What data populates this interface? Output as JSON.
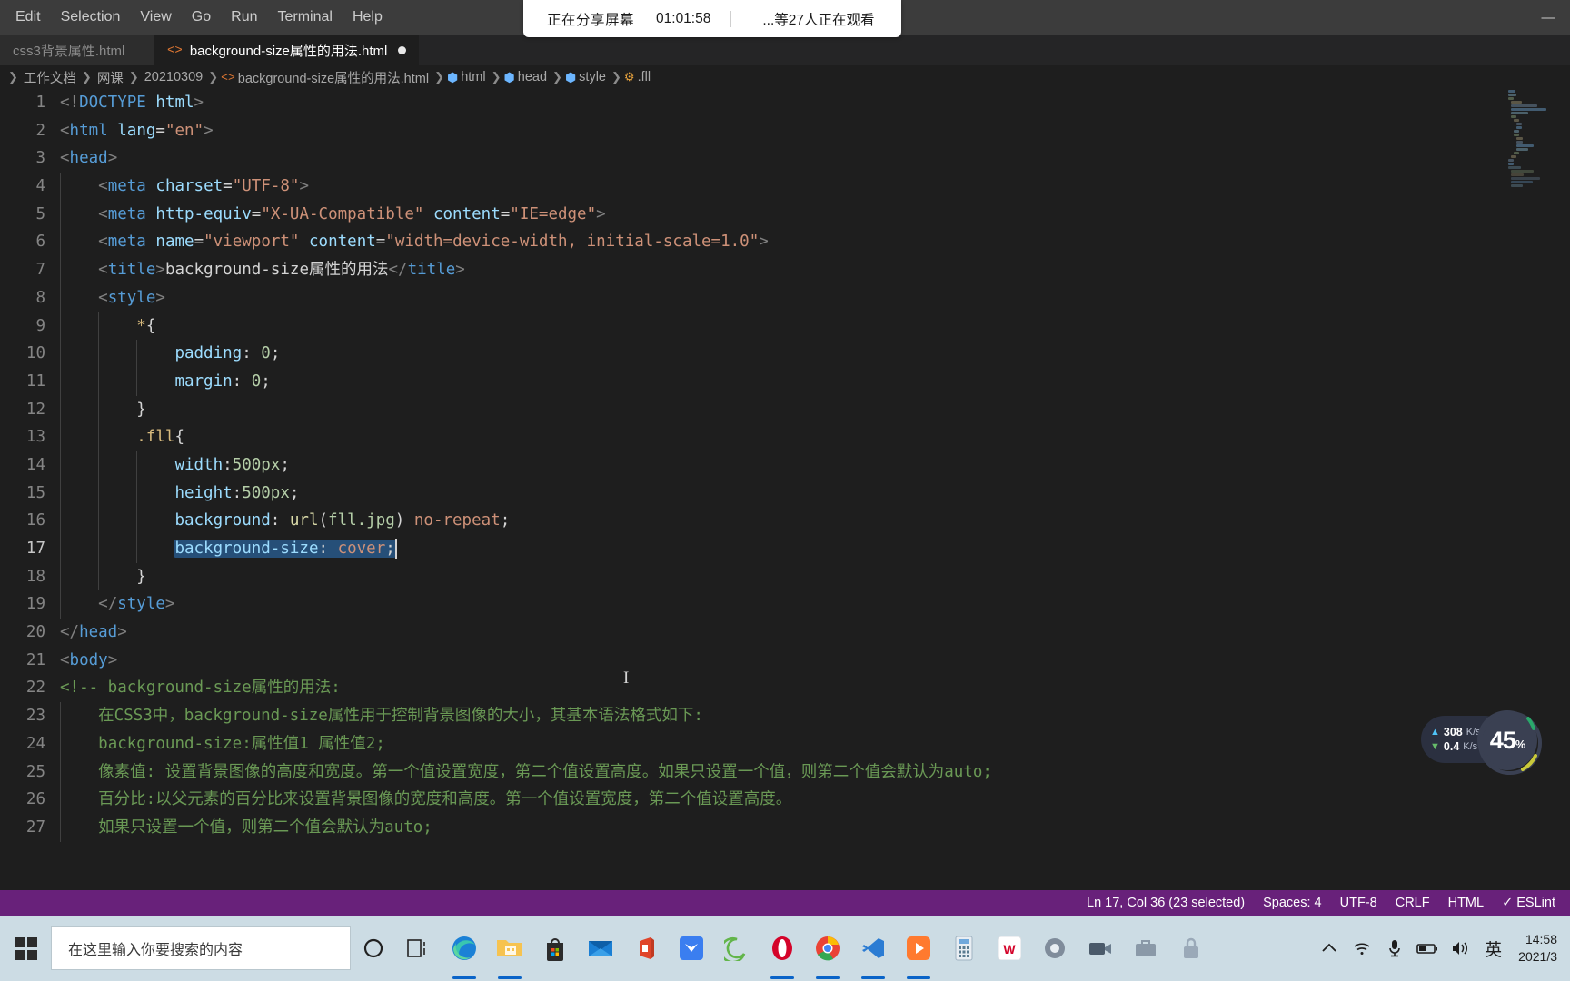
{
  "window": {
    "menu": [
      "Edit",
      "Selection",
      "View",
      "Go",
      "Run",
      "Terminal",
      "Help"
    ],
    "minimize_glyph": "—"
  },
  "share_banner": {
    "status": "正在分享屏幕",
    "timer": "01:01:58",
    "viewers": "...等27人正在观看"
  },
  "tabs": [
    {
      "label": "css3背景属性.html",
      "active": false,
      "dirty": false,
      "icon": "html-file-icon"
    },
    {
      "label": "background-size属性的用法.html",
      "active": true,
      "dirty": true,
      "icon": "html-file-icon"
    }
  ],
  "breadcrumb": [
    {
      "label": "工作文档",
      "icon": ""
    },
    {
      "label": "网课",
      "icon": ""
    },
    {
      "label": "20210309",
      "icon": ""
    },
    {
      "label": "background-size属性的用法.html",
      "icon": "html-file-icon"
    },
    {
      "label": "html",
      "icon": "symbol-cube-icon"
    },
    {
      "label": "head",
      "icon": "symbol-cube-icon"
    },
    {
      "label": "style",
      "icon": "symbol-cube-icon"
    },
    {
      "label": ".fll",
      "icon": "css-rule-icon"
    }
  ],
  "editor": {
    "first_line": 1,
    "lines": [
      {
        "n": 1,
        "indent": 0,
        "tokens": [
          {
            "t": "punct",
            "s": "<!"
          },
          {
            "t": "tag",
            "s": "DOCTYPE"
          },
          {
            "t": "plain",
            "s": " "
          },
          {
            "t": "attr",
            "s": "html"
          },
          {
            "t": "punct",
            "s": ">"
          }
        ]
      },
      {
        "n": 2,
        "indent": 0,
        "tokens": [
          {
            "t": "punct",
            "s": "<"
          },
          {
            "t": "tag",
            "s": "html"
          },
          {
            "t": "plain",
            "s": " "
          },
          {
            "t": "attr",
            "s": "lang"
          },
          {
            "t": "plain",
            "s": "="
          },
          {
            "t": "str",
            "s": "\"en\""
          },
          {
            "t": "punct",
            "s": ">"
          }
        ]
      },
      {
        "n": 3,
        "indent": 0,
        "tokens": [
          {
            "t": "punct",
            "s": "<"
          },
          {
            "t": "tag",
            "s": "head"
          },
          {
            "t": "punct",
            "s": ">"
          }
        ]
      },
      {
        "n": 4,
        "indent": 1,
        "tokens": [
          {
            "t": "punct",
            "s": "<"
          },
          {
            "t": "tag",
            "s": "meta"
          },
          {
            "t": "plain",
            "s": " "
          },
          {
            "t": "attr",
            "s": "charset"
          },
          {
            "t": "plain",
            "s": "="
          },
          {
            "t": "str",
            "s": "\"UTF-8\""
          },
          {
            "t": "punct",
            "s": ">"
          }
        ]
      },
      {
        "n": 5,
        "indent": 1,
        "tokens": [
          {
            "t": "punct",
            "s": "<"
          },
          {
            "t": "tag",
            "s": "meta"
          },
          {
            "t": "plain",
            "s": " "
          },
          {
            "t": "attr",
            "s": "http-equiv"
          },
          {
            "t": "plain",
            "s": "="
          },
          {
            "t": "str",
            "s": "\"X-UA-Compatible\""
          },
          {
            "t": "plain",
            "s": " "
          },
          {
            "t": "attr",
            "s": "content"
          },
          {
            "t": "plain",
            "s": "="
          },
          {
            "t": "str",
            "s": "\"IE=edge\""
          },
          {
            "t": "punct",
            "s": ">"
          }
        ]
      },
      {
        "n": 6,
        "indent": 1,
        "tokens": [
          {
            "t": "punct",
            "s": "<"
          },
          {
            "t": "tag",
            "s": "meta"
          },
          {
            "t": "plain",
            "s": " "
          },
          {
            "t": "attr",
            "s": "name"
          },
          {
            "t": "plain",
            "s": "="
          },
          {
            "t": "str",
            "s": "\"viewport\""
          },
          {
            "t": "plain",
            "s": " "
          },
          {
            "t": "attr",
            "s": "content"
          },
          {
            "t": "plain",
            "s": "="
          },
          {
            "t": "str",
            "s": "\"width=device-width, initial-scale=1.0\""
          },
          {
            "t": "punct",
            "s": ">"
          }
        ]
      },
      {
        "n": 7,
        "indent": 1,
        "tokens": [
          {
            "t": "punct",
            "s": "<"
          },
          {
            "t": "tag",
            "s": "title"
          },
          {
            "t": "punct",
            "s": ">"
          },
          {
            "t": "plain",
            "s": "background-size属性的用法"
          },
          {
            "t": "punct",
            "s": "</"
          },
          {
            "t": "tag",
            "s": "title"
          },
          {
            "t": "punct",
            "s": ">"
          }
        ]
      },
      {
        "n": 8,
        "indent": 1,
        "tokens": [
          {
            "t": "punct",
            "s": "<"
          },
          {
            "t": "tag",
            "s": "style"
          },
          {
            "t": "punct",
            "s": ">"
          }
        ]
      },
      {
        "n": 9,
        "indent": 2,
        "tokens": [
          {
            "t": "sel",
            "s": "*"
          },
          {
            "t": "brace",
            "s": "{"
          }
        ]
      },
      {
        "n": 10,
        "indent": 3,
        "tokens": [
          {
            "t": "prop",
            "s": "padding"
          },
          {
            "t": "plain",
            "s": ": "
          },
          {
            "t": "num",
            "s": "0"
          },
          {
            "t": "plain",
            "s": ";"
          }
        ]
      },
      {
        "n": 11,
        "indent": 3,
        "tokens": [
          {
            "t": "prop",
            "s": "margin"
          },
          {
            "t": "plain",
            "s": ": "
          },
          {
            "t": "num",
            "s": "0"
          },
          {
            "t": "plain",
            "s": ";"
          }
        ]
      },
      {
        "n": 12,
        "indent": 2,
        "tokens": [
          {
            "t": "brace",
            "s": "}"
          }
        ]
      },
      {
        "n": 13,
        "indent": 2,
        "tokens": [
          {
            "t": "sel",
            "s": ".fll"
          },
          {
            "t": "brace",
            "s": "{"
          }
        ]
      },
      {
        "n": 14,
        "indent": 3,
        "tokens": [
          {
            "t": "prop",
            "s": "width"
          },
          {
            "t": "plain",
            "s": ":"
          },
          {
            "t": "num",
            "s": "500px"
          },
          {
            "t": "plain",
            "s": ";"
          }
        ]
      },
      {
        "n": 15,
        "indent": 3,
        "tokens": [
          {
            "t": "prop",
            "s": "height"
          },
          {
            "t": "plain",
            "s": ":"
          },
          {
            "t": "num",
            "s": "500px"
          },
          {
            "t": "plain",
            "s": ";"
          }
        ]
      },
      {
        "n": 16,
        "indent": 3,
        "tokens": [
          {
            "t": "prop",
            "s": "background"
          },
          {
            "t": "plain",
            "s": ": "
          },
          {
            "t": "fn",
            "s": "url"
          },
          {
            "t": "plain",
            "s": "("
          },
          {
            "t": "num",
            "s": "fll.jpg"
          },
          {
            "t": "plain",
            "s": ") "
          },
          {
            "t": "val",
            "s": "no-repeat"
          },
          {
            "t": "plain",
            "s": ";"
          }
        ]
      },
      {
        "n": 17,
        "indent": 3,
        "current": true,
        "selected": true,
        "tokens": [
          {
            "t": "prop",
            "s": "background-size"
          },
          {
            "t": "plain",
            "s": ": "
          },
          {
            "t": "val",
            "s": "cover"
          },
          {
            "t": "plain",
            "s": ";"
          }
        ]
      },
      {
        "n": 18,
        "indent": 2,
        "tokens": [
          {
            "t": "brace",
            "s": "}"
          }
        ]
      },
      {
        "n": 19,
        "indent": 1,
        "tokens": [
          {
            "t": "punct",
            "s": "</"
          },
          {
            "t": "tag",
            "s": "style"
          },
          {
            "t": "punct",
            "s": ">"
          }
        ]
      },
      {
        "n": 20,
        "indent": 0,
        "tokens": [
          {
            "t": "punct",
            "s": "</"
          },
          {
            "t": "tag",
            "s": "head"
          },
          {
            "t": "punct",
            "s": ">"
          }
        ]
      },
      {
        "n": 21,
        "indent": 0,
        "tokens": [
          {
            "t": "punct",
            "s": "<"
          },
          {
            "t": "tag",
            "s": "body"
          },
          {
            "t": "punct",
            "s": ">"
          }
        ]
      },
      {
        "n": 22,
        "indent": 0,
        "tokens": [
          {
            "t": "comment",
            "s": "<!-- background-size属性的用法:"
          }
        ]
      },
      {
        "n": 23,
        "indent": 1,
        "tokens": [
          {
            "t": "comment",
            "s": "在CSS3中，background-size属性用于控制背景图像的大小，其基本语法格式如下:"
          }
        ]
      },
      {
        "n": 24,
        "indent": 1,
        "tokens": [
          {
            "t": "comment",
            "s": "background-size:属性值1 属性值2;"
          }
        ]
      },
      {
        "n": 25,
        "indent": 1,
        "tokens": [
          {
            "t": "comment",
            "s": "像素值: 设置背景图像的高度和宽度。第一个值设置宽度，第二个值设置高度。如果只设置一个值，则第二个值会默认为auto;"
          }
        ]
      },
      {
        "n": 26,
        "indent": 1,
        "tokens": [
          {
            "t": "comment",
            "s": "百分比:以父元素的百分比来设置背景图像的宽度和高度。第一个值设置宽度，第二个值设置高度。"
          }
        ]
      },
      {
        "n": 27,
        "indent": 1,
        "tokens": [
          {
            "t": "comment",
            "s": "如果只设置一个值，则第二个值会默认为auto;"
          }
        ]
      }
    ]
  },
  "statusbar": {
    "position": "Ln 17, Col 36 (23 selected)",
    "spaces": "Spaces: 4",
    "encoding": "UTF-8",
    "eol": "CRLF",
    "language": "HTML",
    "eslint": "ESLint",
    "eslint_icon": "check-icon"
  },
  "network_widget": {
    "upload": "308",
    "upload_unit": "K/s",
    "download": "0.4",
    "download_unit": "K/s",
    "percent": "45",
    "percent_sign": "%"
  },
  "taskbar": {
    "search_placeholder": "在这里输入你要搜索的内容",
    "start_icon": "windows-logo-icon",
    "cortana_icon": "cortana-circle-icon",
    "taskview_icon": "task-view-icon",
    "apps": [
      {
        "name": "edge-icon",
        "glyph": "e",
        "color": "#3b7fd4"
      },
      {
        "name": "file-explorer-icon",
        "glyph": "",
        "color": "#ffc942"
      },
      {
        "name": "microsoft-store-icon",
        "glyph": "",
        "color": "#2a2a2a"
      },
      {
        "name": "mail-icon",
        "glyph": "",
        "color": "#1f7fd4"
      },
      {
        "name": "office-icon",
        "glyph": "",
        "color": "#e0452a"
      },
      {
        "name": "foxmail-icon",
        "glyph": "",
        "color": "#3a7ef0"
      },
      {
        "name": "internet-explorer-icon",
        "glyph": "e",
        "color": "#62b54a"
      },
      {
        "name": "opera-icon",
        "glyph": "O",
        "color": "#d4042a"
      },
      {
        "name": "chrome-icon",
        "glyph": "",
        "color": "#ea4335"
      },
      {
        "name": "vscode-icon",
        "glyph": "",
        "color": "#2b7cd3"
      },
      {
        "name": "player-icon",
        "glyph": "▶",
        "color": "#ff7a2f"
      },
      {
        "name": "calculator-icon",
        "glyph": "",
        "color": "#5a9fd4"
      },
      {
        "name": "wps-icon",
        "glyph": "W",
        "color": "#d4042a"
      },
      {
        "name": "recorder-icon",
        "glyph": "",
        "color": "#7f8c9b"
      },
      {
        "name": "camera-icon",
        "glyph": "",
        "color": "#4a5a6a"
      },
      {
        "name": "briefcase-icon",
        "glyph": "",
        "color": "#8a99a8"
      },
      {
        "name": "lock-icon",
        "glyph": "",
        "color": "#9aa9b8"
      }
    ],
    "tray": [
      {
        "name": "show-hidden-icons-icon",
        "glyph": "⌃"
      },
      {
        "name": "wifi-icon",
        "glyph": "◠"
      },
      {
        "name": "microphone-icon",
        "glyph": "⬤"
      },
      {
        "name": "battery-icon",
        "glyph": "▬"
      },
      {
        "name": "volume-icon",
        "glyph": "ᴘ"
      }
    ],
    "lang": "英",
    "time": "14:58",
    "date": "2021/3"
  }
}
